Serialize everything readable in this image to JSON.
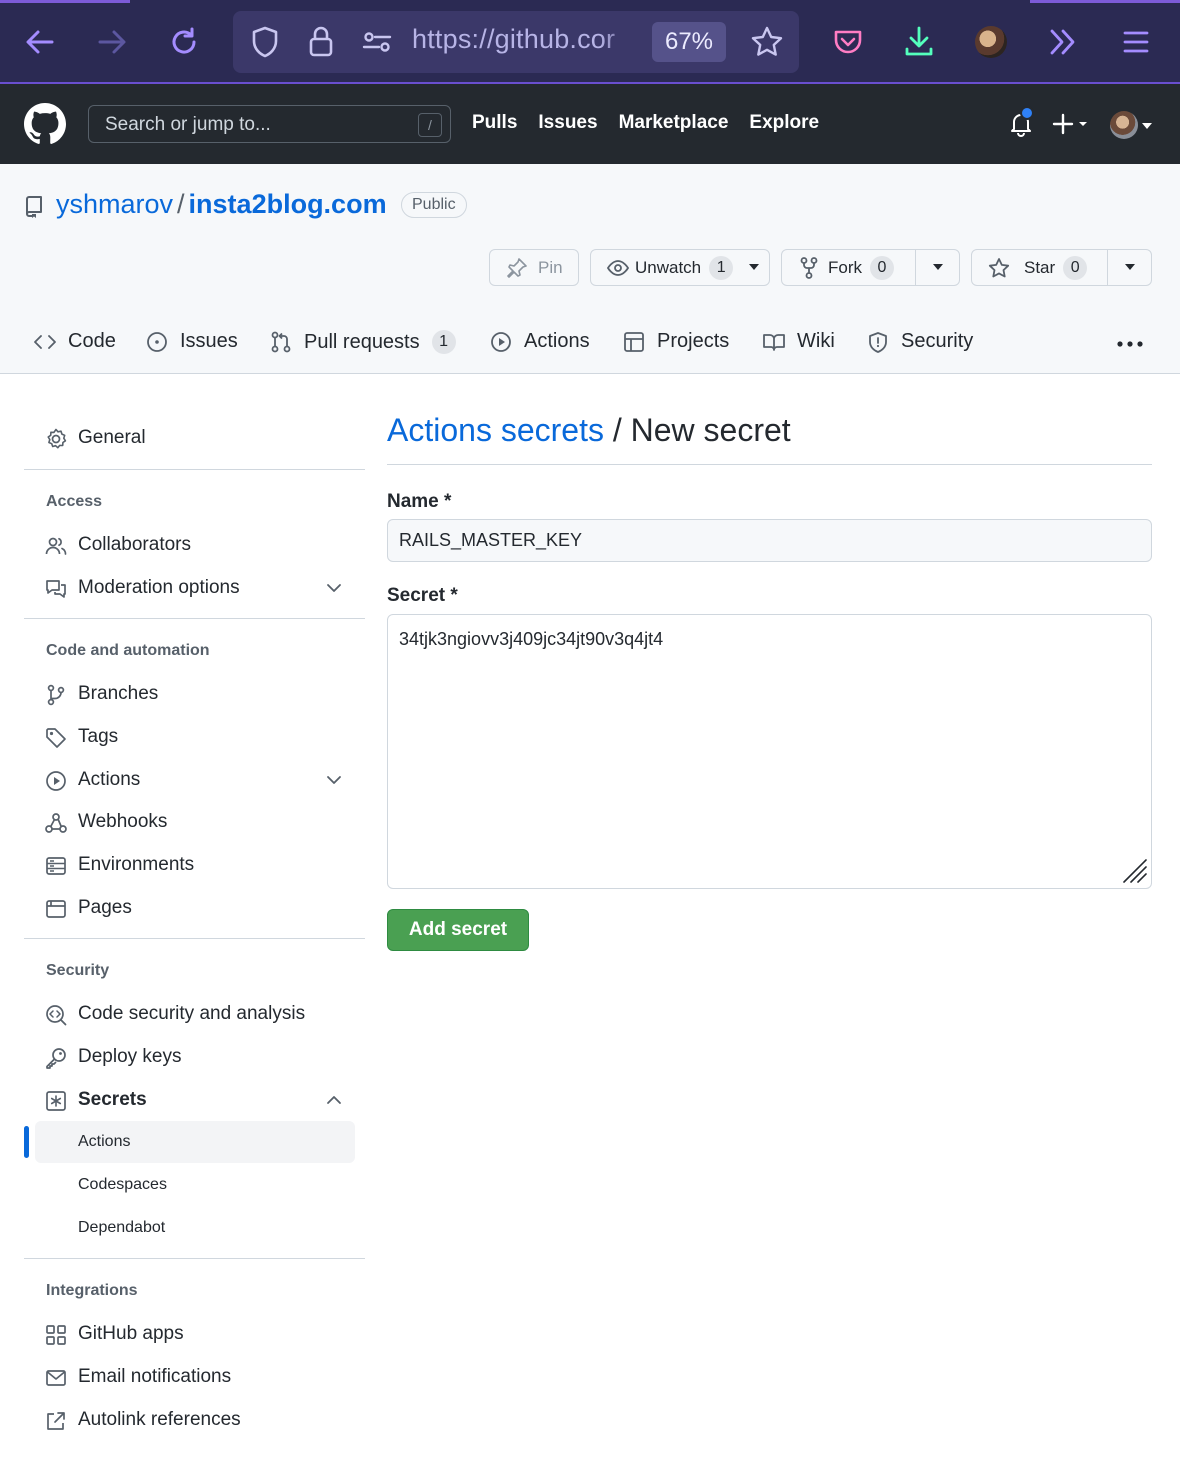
{
  "browser": {
    "url": "https://github.com/yshmarov/insta2blog.com/settings/secrets/actions/new",
    "url_visible": "https://github.cor",
    "zoom": "67%",
    "colors": {
      "toolbar_bg": "#2b2a53",
      "url_bg": "#3b3869",
      "icon": "#a48cff",
      "download": "#54ffbd"
    }
  },
  "github_header": {
    "search_placeholder": "Search or jump to...",
    "slash_hint": "/",
    "nav": {
      "pulls": "Pulls",
      "issues": "Issues",
      "marketplace": "Marketplace",
      "explore": "Explore"
    }
  },
  "repo": {
    "owner": "yshmarov",
    "separator": "/",
    "name": "insta2blog.com",
    "visibility": "Public",
    "actions": {
      "pin": "Pin",
      "unwatch": "Unwatch",
      "unwatch_count": "1",
      "fork": "Fork",
      "fork_count": "0",
      "star": "Star",
      "star_count": "0"
    },
    "tabs": {
      "code": "Code",
      "issues": "Issues",
      "pull_requests": "Pull requests",
      "pull_requests_count": "1",
      "actions": "Actions",
      "projects": "Projects",
      "wiki": "Wiki",
      "security": "Security"
    }
  },
  "sidebar": {
    "general": "General",
    "access_heading": "Access",
    "collaborators": "Collaborators",
    "moderation": "Moderation options",
    "code_heading": "Code and automation",
    "branches": "Branches",
    "tags": "Tags",
    "actions": "Actions",
    "webhooks": "Webhooks",
    "environments": "Environments",
    "pages": "Pages",
    "security_heading": "Security",
    "code_security": "Code security and analysis",
    "deploy_keys": "Deploy keys",
    "secrets": "Secrets",
    "secrets_actions": "Actions",
    "secrets_codespaces": "Codespaces",
    "secrets_dependabot": "Dependabot",
    "integrations_heading": "Integrations",
    "github_apps": "GitHub apps",
    "email_notifications": "Email notifications",
    "autolink": "Autolink references"
  },
  "form": {
    "breadcrumb_link": "Actions secrets",
    "breadcrumb_rest": " / New secret",
    "name_label": "Name *",
    "name_value": "RAILS_MASTER_KEY",
    "secret_label": "Secret *",
    "secret_value": "34tjk3ngiovv3j409jc34jt90v3q4jt4",
    "submit": "Add secret"
  }
}
